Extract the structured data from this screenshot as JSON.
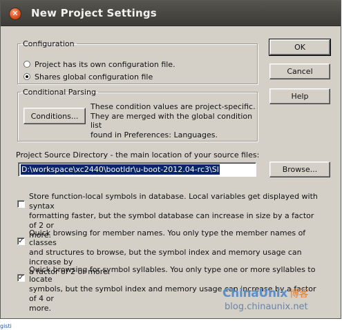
{
  "window": {
    "title": "New Project Settings"
  },
  "configuration": {
    "legend": "Configuration",
    "options": [
      {
        "label": "Project has its own configuration file.",
        "selected": false
      },
      {
        "label": "Shares global configuration file",
        "selected": true
      }
    ]
  },
  "conditional": {
    "legend": "Conditional Parsing",
    "button_label": "Conditions...",
    "description": [
      "These condition values are project-specific.",
      "They are merged with the global condition list",
      "found in Preferences: Languages."
    ]
  },
  "source_dir": {
    "label": "Project Source Directory - the main location of your source files:",
    "value": "D:\\workspace\\xc2440\\bootldr\\u-boot-2012.04-rc3\\SI",
    "browse_label": "Browse..."
  },
  "actions": {
    "ok": "OK",
    "cancel": "Cancel",
    "help": "Help"
  },
  "options": [
    {
      "checked": false,
      "lines": [
        "Store function-local symbols in database.  Local variables get displayed with syntax",
        "formatting faster, but the symbol database can increase in size by a factor of 2 or",
        "more."
      ]
    },
    {
      "checked": true,
      "lines": [
        "Quick browsing for member names.  You only type the member names of classes",
        "and structures to browse, but the symbol index and memory usage can increase by",
        "a factor of 2 or more."
      ]
    },
    {
      "checked": true,
      "lines": [
        "Quick browsing for symbol syllables.  You only type one or more syllables to locate",
        "symbols, but the symbol index and memory usage can increase by a factor of 4 or",
        "more."
      ]
    }
  ],
  "watermark": {
    "brand": "ChinaUnix",
    "brand_cn": "博客",
    "url": "blog.chinaunix.net"
  },
  "status_fragment": "gisti"
}
